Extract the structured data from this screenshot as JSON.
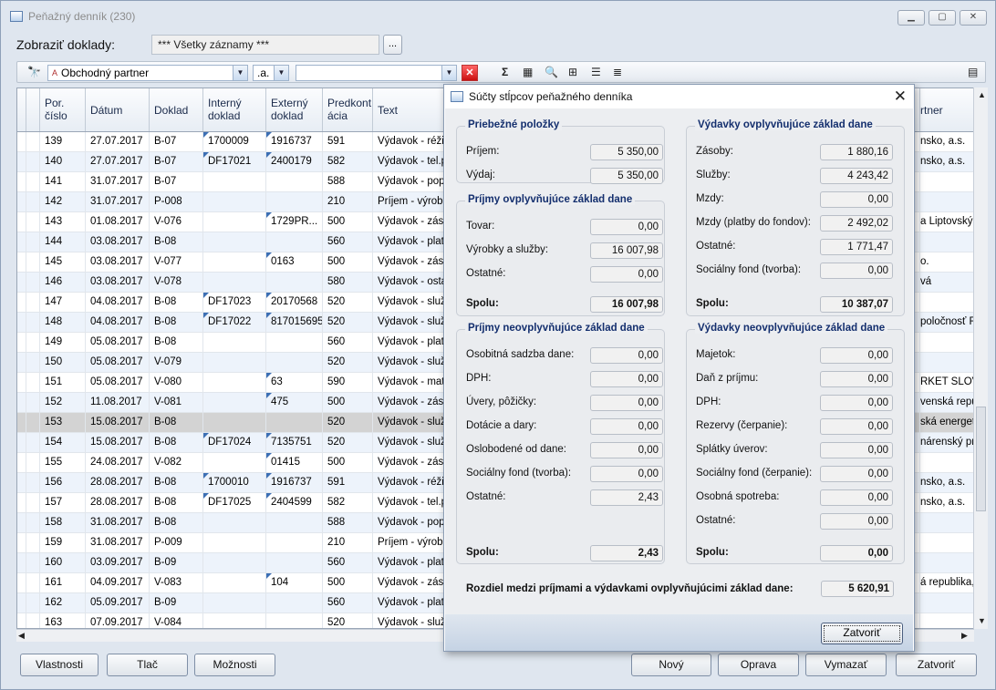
{
  "window": {
    "title": "Peňažný denník (230)"
  },
  "filter": {
    "label": "Zobraziť doklady:",
    "value": "*** Všetky záznamy ***",
    "browse": "..."
  },
  "toolbar": {
    "partner": "Obchodný partner",
    "op": ".a.",
    "search": ""
  },
  "columns": [
    "Por. číslo",
    "Dátum",
    "Doklad",
    "Interný doklad",
    "Externý doklad",
    "Predkont ácia",
    "Text",
    "rtner"
  ],
  "rows": [
    {
      "n": "139",
      "d": "27.07.2017",
      "dok": "B-07",
      "int": "1700009",
      "ext": "1916737",
      "pk": "591",
      "text": "Výdavok - réžia",
      "p": "nsko, a.s.",
      "mi": true,
      "me": true
    },
    {
      "n": "140",
      "d": "27.07.2017",
      "dok": "B-07",
      "int": "DF17021",
      "ext": "2400179",
      "pk": "582",
      "text": "Výdavok - tel.p",
      "p": "nsko, a.s.",
      "mi": true,
      "me": true
    },
    {
      "n": "141",
      "d": "31.07.2017",
      "dok": "B-07",
      "int": "",
      "ext": "",
      "pk": "588",
      "text": "Výdavok - popl",
      "p": ""
    },
    {
      "n": "142",
      "d": "31.07.2017",
      "dok": "P-008",
      "int": "",
      "ext": "",
      "pk": "210",
      "text": "Príjem - výrobky",
      "p": ""
    },
    {
      "n": "143",
      "d": "01.08.2017",
      "dok": "V-076",
      "int": "",
      "ext": "1729PR...",
      "pk": "500",
      "text": "Výdavok - záso",
      "p": "a Liptovský M",
      "me": true
    },
    {
      "n": "144",
      "d": "03.08.2017",
      "dok": "B-08",
      "int": "",
      "ext": "",
      "pk": "560",
      "text": "Výdavok - platb",
      "p": ""
    },
    {
      "n": "145",
      "d": "03.08.2017",
      "dok": "V-077",
      "int": "",
      "ext": "0163",
      "pk": "500",
      "text": "Výdavok - záso",
      "p": "o.",
      "me": true
    },
    {
      "n": "146",
      "d": "03.08.2017",
      "dok": "V-078",
      "int": "",
      "ext": "",
      "pk": "580",
      "text": "Výdavok - ostat",
      "p": "vá"
    },
    {
      "n": "147",
      "d": "04.08.2017",
      "dok": "B-08",
      "int": "DF17023",
      "ext": "20170568",
      "pk": "520",
      "text": "Výdavok - služb",
      "p": "",
      "mi": true,
      "me": true
    },
    {
      "n": "148",
      "d": "04.08.2017",
      "dok": "B-08",
      "int": "DF17022",
      "ext": "817015695",
      "pk": "520",
      "text": "Výdavok - služb",
      "p": "poločnosť R",
      "mi": true,
      "me": true
    },
    {
      "n": "149",
      "d": "05.08.2017",
      "dok": "B-08",
      "int": "",
      "ext": "",
      "pk": "560",
      "text": "Výdavok - platb",
      "p": ""
    },
    {
      "n": "150",
      "d": "05.08.2017",
      "dok": "V-079",
      "int": "",
      "ext": "",
      "pk": "520",
      "text": "Výdavok - služb",
      "p": ""
    },
    {
      "n": "151",
      "d": "05.08.2017",
      "dok": "V-080",
      "int": "",
      "ext": "63",
      "pk": "590",
      "text": "Výdavok - mate",
      "p": "RKET SLOVAK",
      "me": true
    },
    {
      "n": "152",
      "d": "11.08.2017",
      "dok": "V-081",
      "int": "",
      "ext": "475",
      "pk": "500",
      "text": "Výdavok - záso",
      "p": "venská repub",
      "me": true
    },
    {
      "n": "153",
      "d": "15.08.2017",
      "dok": "B-08",
      "int": "",
      "ext": "",
      "pk": "520",
      "text": "Výdavok - služb",
      "p": "ská energetil",
      "sel": true
    },
    {
      "n": "154",
      "d": "15.08.2017",
      "dok": "B-08",
      "int": "DF17024",
      "ext": "7135751",
      "pk": "520",
      "text": "Výdavok - služb",
      "p": "nárenský pri",
      "mi": true,
      "me": true
    },
    {
      "n": "155",
      "d": "24.08.2017",
      "dok": "V-082",
      "int": "",
      "ext": "01415",
      "pk": "500",
      "text": "Výdavok - záso",
      "p": "",
      "me": true
    },
    {
      "n": "156",
      "d": "28.08.2017",
      "dok": "B-08",
      "int": "1700010",
      "ext": "1916737",
      "pk": "591",
      "text": "Výdavok - réžia",
      "p": "nsko, a.s.",
      "mi": true,
      "me": true
    },
    {
      "n": "157",
      "d": "28.08.2017",
      "dok": "B-08",
      "int": "DF17025",
      "ext": "2404599",
      "pk": "582",
      "text": "Výdavok - tel.p",
      "p": "nsko, a.s.",
      "mi": true,
      "me": true
    },
    {
      "n": "158",
      "d": "31.08.2017",
      "dok": "B-08",
      "int": "",
      "ext": "",
      "pk": "588",
      "text": "Výdavok - popl",
      "p": ""
    },
    {
      "n": "159",
      "d": "31.08.2017",
      "dok": "P-009",
      "int": "",
      "ext": "",
      "pk": "210",
      "text": "Príjem - výrobky",
      "p": ""
    },
    {
      "n": "160",
      "d": "03.09.2017",
      "dok": "B-09",
      "int": "",
      "ext": "",
      "pk": "560",
      "text": "Výdavok - platb",
      "p": ""
    },
    {
      "n": "161",
      "d": "04.09.2017",
      "dok": "V-083",
      "int": "",
      "ext": "104",
      "pk": "500",
      "text": "Výdavok - záso",
      "p": "á republika, v",
      "me": true
    },
    {
      "n": "162",
      "d": "05.09.2017",
      "dok": "B-09",
      "int": "",
      "ext": "",
      "pk": "560",
      "text": "Výdavok - platb",
      "p": ""
    },
    {
      "n": "163",
      "d": "07.09.2017",
      "dok": "V-084",
      "int": "",
      "ext": "",
      "pk": "520",
      "text": "Výdavok - služb",
      "p": ""
    }
  ],
  "buttons": {
    "vlastnosti": "Vlastnosti",
    "tlac": "Tlač",
    "moznosti": "Možnosti",
    "novy": "Nový",
    "oprava": "Oprava",
    "vymazat": "Vymazať",
    "zatvorit": "Zatvoriť"
  },
  "dialog": {
    "title": "Súčty stĺpcov peňažného denníka",
    "close": "✕",
    "groups": [
      {
        "key": "priebezne",
        "title": "Priebežné položky",
        "items": [
          {
            "label": "Príjem:",
            "value": "5 350,00"
          },
          {
            "label": "Výdaj:",
            "value": "5 350,00"
          }
        ]
      },
      {
        "key": "vydOvpl",
        "title": "Výdavky ovplyvňujúce základ dane",
        "items": [
          {
            "label": "Zásoby:",
            "value": "1 880,16"
          },
          {
            "label": "Služby:",
            "value": "4 243,42"
          },
          {
            "label": "Mzdy:",
            "value": "0,00"
          },
          {
            "label": "Mzdy (platby do fondov):",
            "value": "2 492,02"
          },
          {
            "label": "Ostatné:",
            "value": "1 771,47"
          },
          {
            "label": "Sociálny fond (tvorba):",
            "value": "0,00"
          }
        ],
        "sum": {
          "label": "Spolu:",
          "value": "10 387,07"
        }
      },
      {
        "key": "prijOvpl",
        "title": "Príjmy ovplyvňujúce základ dane",
        "items": [
          {
            "label": "Tovar:",
            "value": "0,00"
          },
          {
            "label": "Výrobky a služby:",
            "value": "16 007,98"
          },
          {
            "label": "Ostatné:",
            "value": "0,00"
          }
        ],
        "sum": {
          "label": "Spolu:",
          "value": "16 007,98"
        }
      },
      {
        "key": "prijNeovpl",
        "title": "Príjmy neovplyvňujúce základ dane",
        "items": [
          {
            "label": "Osobitná sadzba dane:",
            "value": "0,00"
          },
          {
            "label": "DPH:",
            "value": "0,00"
          },
          {
            "label": "Úvery, pôžičky:",
            "value": "0,00"
          },
          {
            "label": "Dotácie a dary:",
            "value": "0,00"
          },
          {
            "label": "Oslobodené od dane:",
            "value": "0,00"
          },
          {
            "label": "Sociálny fond (tvorba):",
            "value": "0,00"
          },
          {
            "label": "Ostatné:",
            "value": "2,43"
          }
        ],
        "sum": {
          "label": "Spolu:",
          "value": "2,43"
        }
      },
      {
        "key": "vydNeovpl",
        "title": "Výdavky neovplyvňujúce základ dane",
        "items": [
          {
            "label": "Majetok:",
            "value": "0,00"
          },
          {
            "label": "Daň z príjmu:",
            "value": "0,00"
          },
          {
            "label": "DPH:",
            "value": "0,00"
          },
          {
            "label": "Rezervy (čerpanie):",
            "value": "0,00"
          },
          {
            "label": "Splátky úverov:",
            "value": "0,00"
          },
          {
            "label": "Sociálny fond (čerpanie):",
            "value": "0,00"
          },
          {
            "label": "Osobná spotreba:",
            "value": "0,00"
          },
          {
            "label": "Ostatné:",
            "value": "0,00"
          }
        ],
        "sum": {
          "label": "Spolu:",
          "value": "0,00"
        }
      }
    ],
    "rozdiel": {
      "label": "Rozdiel medzi príjmami a výdavkami ovplyvňujúcimi základ dane:",
      "value": "5 620,91"
    },
    "close_button": "Zatvoriť"
  }
}
